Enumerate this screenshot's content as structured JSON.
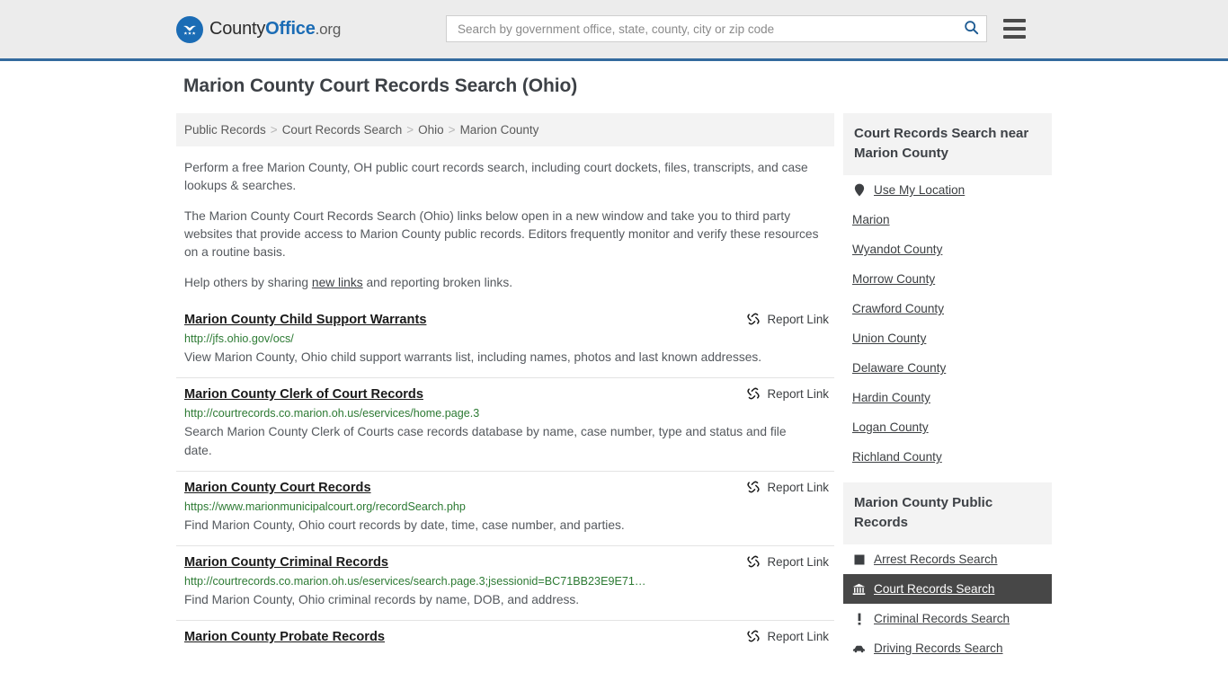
{
  "header": {
    "logo": {
      "icon": "eagle-shield-icon",
      "text_county": "County",
      "text_office": "Office",
      "text_org": ".org"
    },
    "search": {
      "placeholder": "Search by government office, state, county, city or zip code",
      "value": "",
      "search_icon": "search-icon"
    },
    "menu_icon": "hamburger-menu-icon"
  },
  "page": {
    "title": "Marion County Court Records Search (Ohio)"
  },
  "breadcrumb": {
    "items": [
      "Public Records",
      "Court Records Search",
      "Ohio",
      "Marion County"
    ],
    "separator": ">"
  },
  "intro": {
    "p1": "Perform a free Marion County, OH public court records search, including court dockets, files, transcripts, and case lookups & searches.",
    "p2": "The Marion County Court Records Search (Ohio) links below open in a new window and take you to third party websites that provide access to Marion County public records. Editors frequently monitor and verify these resources on a routine basis.",
    "p3_before": "Help others by sharing ",
    "p3_link": "new links",
    "p3_after": " and reporting broken links."
  },
  "results": {
    "report_label": "Report Link",
    "report_icon": "broken-link-icon",
    "items": [
      {
        "title": "Marion County Child Support Warrants",
        "url": "http://jfs.ohio.gov/ocs/",
        "description": "View Marion County, Ohio child support warrants list, including names, photos and last known addresses."
      },
      {
        "title": "Marion County Clerk of Court Records",
        "url": "http://courtrecords.co.marion.oh.us/eservices/home.page.3",
        "description": "Search Marion County Clerk of Courts case records database by name, case number, type and status and file date."
      },
      {
        "title": "Marion County Court Records",
        "url": "https://www.marionmunicipalcourt.org/recordSearch.php",
        "description": "Find Marion County, Ohio court records by date, time, case number, and parties."
      },
      {
        "title": "Marion County Criminal Records",
        "url": "http://courtrecords.co.marion.oh.us/eservices/search.page.3;jsessionid=BC71BB23E9E71…",
        "description": "Find Marion County, Ohio criminal records by name, DOB, and address."
      },
      {
        "title": "Marion County Probate Records",
        "url": "",
        "description": ""
      }
    ]
  },
  "sidebar": {
    "nearby": {
      "heading": "Court Records Search near Marion County",
      "items": [
        {
          "label": "Use My Location",
          "icon": "map-pin-icon"
        },
        {
          "label": "Marion",
          "icon": ""
        },
        {
          "label": "Wyandot County",
          "icon": ""
        },
        {
          "label": "Morrow County",
          "icon": ""
        },
        {
          "label": "Crawford County",
          "icon": ""
        },
        {
          "label": "Union County",
          "icon": ""
        },
        {
          "label": "Delaware County",
          "icon": ""
        },
        {
          "label": "Hardin County",
          "icon": ""
        },
        {
          "label": "Logan County",
          "icon": ""
        },
        {
          "label": "Richland County",
          "icon": ""
        }
      ]
    },
    "public_records": {
      "heading": "Marion County Public Records",
      "items": [
        {
          "label": "Arrest Records Search",
          "icon": "square-icon",
          "active": false
        },
        {
          "label": "Court Records Search",
          "icon": "courthouse-icon",
          "active": true
        },
        {
          "label": "Criminal Records Search",
          "icon": "exclamation-icon",
          "active": false
        },
        {
          "label": "Driving Records Search",
          "icon": "car-icon",
          "active": false
        }
      ]
    }
  },
  "colors": {
    "header_bg": "#ececec",
    "header_rule": "#336a9e",
    "brand_blue": "#1b6cb5",
    "url_green": "#2c7a33",
    "panel_gray": "#f3f3f3",
    "active_dark": "#474747"
  }
}
